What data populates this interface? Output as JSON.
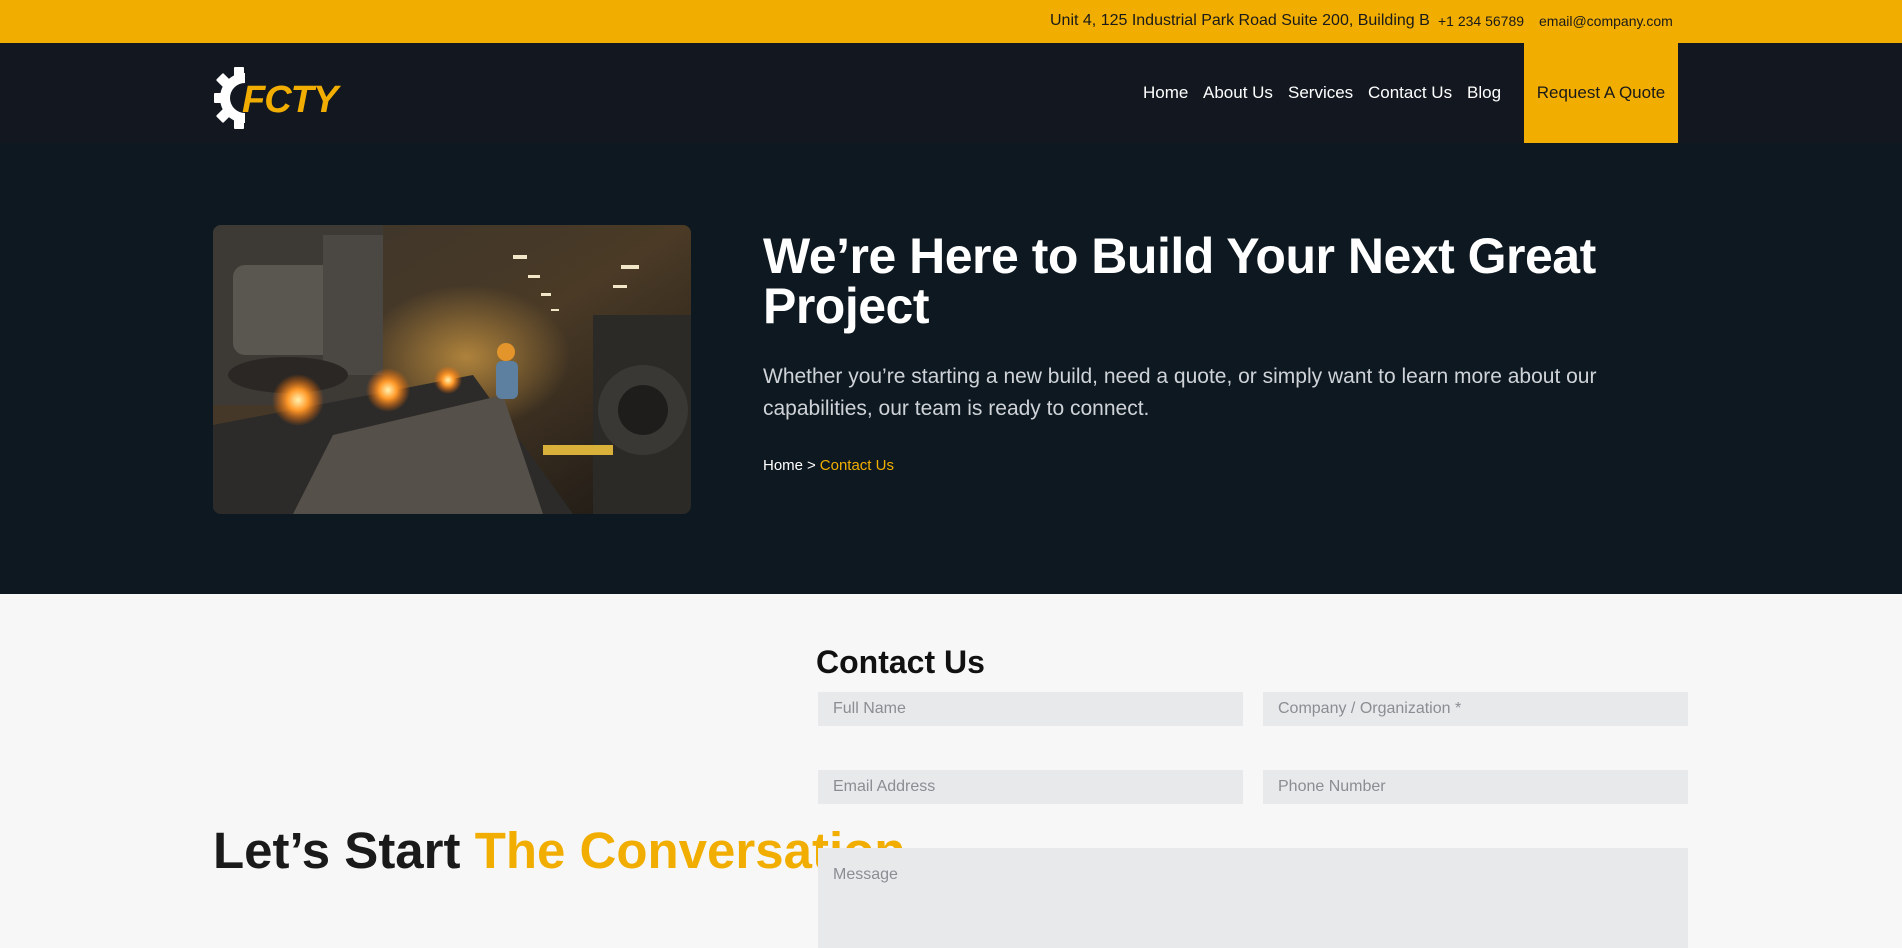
{
  "topbar": {
    "address": "Unit 4, 125 Industrial Park Road Suite 200, Building B",
    "phone": "+1 234 56789",
    "email": "email@company.com"
  },
  "brand": {
    "logo_text": "FCTY",
    "accent_color": "#f2ae00",
    "nav_bg": "#131820",
    "hero_bg": "#0d1820"
  },
  "nav": {
    "items": [
      {
        "label": "Home"
      },
      {
        "label": "About Us"
      },
      {
        "label": "Services"
      },
      {
        "label": "Contact Us"
      },
      {
        "label": "Blog"
      }
    ],
    "cta_label": "Request A Quote"
  },
  "hero": {
    "title": "We’re Here to Build Your Next Great Project",
    "subtitle": "Whether you’re starting a new build, need a quote, or simply want to learn more about our capabilities, our team is ready to connect.",
    "breadcrumb": {
      "home": "Home",
      "separator": ">",
      "current": "Contact Us"
    }
  },
  "intro": {
    "heading_part1": "Let’s Start ",
    "heading_part2": "The Conversation"
  },
  "form": {
    "title": "Contact Us",
    "fields": {
      "full_name": "Full Name",
      "company": "Company / Organization *",
      "email": "Email Address",
      "phone": "Phone Number",
      "message": "Message"
    }
  }
}
